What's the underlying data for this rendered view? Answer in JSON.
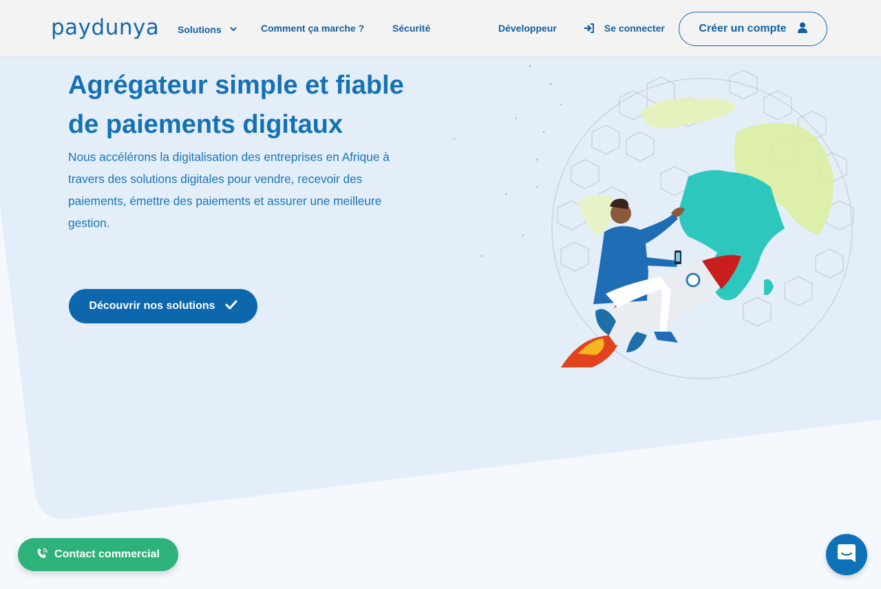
{
  "brand": {
    "logo_text": "paydunya",
    "primary_color": "#0c67ad",
    "accent_green": "#2db37a"
  },
  "nav": {
    "solutions": "Solutions",
    "how_it_works": "Comment ça marche ?",
    "security": "Sécurité",
    "developer": "Développeur",
    "login": "Se connecter",
    "signup": "Créer un compte"
  },
  "hero": {
    "title_line1": "Agrégateur simple et fiable",
    "title_line2": "de paiements digitaux",
    "description": "Nous accélérons la digitalisation des entreprises en Afrique à travers des solutions digitales pour vendre, recevoir des paiements, émettre des paiements et assurer une meilleure gestion.",
    "cta": "Découvrir nos solutions"
  },
  "floating": {
    "contact": "Contact commercial"
  },
  "icons": [
    "chevron-down-icon",
    "login-icon",
    "user-icon",
    "check-icon",
    "phone-icon",
    "chat-icon"
  ]
}
